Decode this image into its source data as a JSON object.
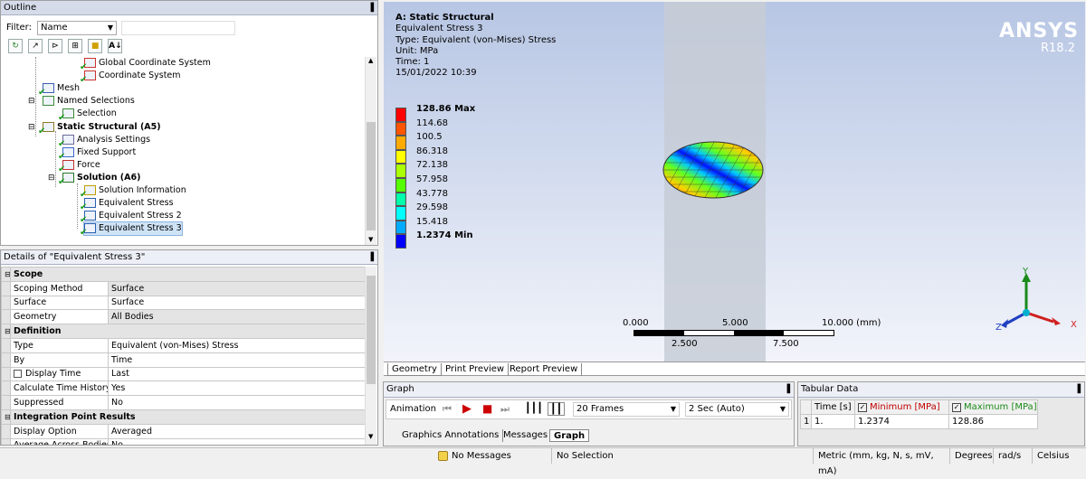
{
  "outline": {
    "title": "Outline",
    "filter_label": "Filter:",
    "filter_value": "Name",
    "tree": [
      {
        "label": "Global Coordinate System",
        "indent": 4,
        "icon": "coordinate-icon",
        "check": true,
        "bold": false
      },
      {
        "label": "Coordinate System",
        "indent": 4,
        "icon": "coordinate-icon",
        "check": true,
        "bold": false
      },
      {
        "label": "Mesh",
        "indent": 2,
        "icon": "mesh-icon",
        "check": true,
        "bold": false
      },
      {
        "label": "Named Selections",
        "indent": 2,
        "icon": "named-selection-icon",
        "check": false,
        "bold": false
      },
      {
        "label": "Selection",
        "indent": 3,
        "icon": "selection-icon",
        "check": true,
        "bold": false
      },
      {
        "label": "Static Structural (A5)",
        "indent": 2,
        "icon": "static-structural-icon",
        "check": true,
        "bold": true
      },
      {
        "label": "Analysis Settings",
        "indent": 3,
        "icon": "analysis-settings-icon",
        "check": true,
        "bold": false
      },
      {
        "label": "Fixed Support",
        "indent": 3,
        "icon": "fixed-support-icon",
        "check": true,
        "bold": false
      },
      {
        "label": "Force",
        "indent": 3,
        "icon": "force-icon",
        "check": true,
        "bold": false
      },
      {
        "label": "Solution (A6)",
        "indent": 3,
        "icon": "solution-icon",
        "check": true,
        "bold": true
      },
      {
        "label": "Solution Information",
        "indent": 4,
        "icon": "solution-information-icon",
        "check": true,
        "bold": false
      },
      {
        "label": "Equivalent Stress",
        "indent": 4,
        "icon": "result-icon",
        "check": true,
        "bold": false
      },
      {
        "label": "Equivalent Stress 2",
        "indent": 4,
        "icon": "result-icon",
        "check": true,
        "bold": false
      },
      {
        "label": "Equivalent Stress 3",
        "indent": 4,
        "icon": "result-icon",
        "check": true,
        "bold": false,
        "selected": true
      }
    ]
  },
  "details": {
    "title": "Details of \"Equivalent Stress 3\"",
    "rows": [
      {
        "section": "Scope"
      },
      {
        "key": "Scoping Method",
        "value": "Surface",
        "shaded": true
      },
      {
        "key": "Surface",
        "value": "Surface"
      },
      {
        "key": "Geometry",
        "value": "All Bodies",
        "shaded": true
      },
      {
        "section": "Definition"
      },
      {
        "key": "Type",
        "value": "Equivalent (von-Mises) Stress"
      },
      {
        "key": "By",
        "value": "Time"
      },
      {
        "key": "Display Time",
        "value": "Last",
        "checkbox": true
      },
      {
        "key": "Calculate Time History",
        "value": "Yes"
      },
      {
        "key": "Suppressed",
        "value": "No"
      },
      {
        "section": "Integration Point Results"
      },
      {
        "key": "Display Option",
        "value": "Averaged"
      },
      {
        "key": "Average Across Bodies",
        "value": "No"
      }
    ]
  },
  "viewport": {
    "header": {
      "title": "A: Static Structural",
      "line1": "Equivalent Stress 3",
      "line2": "Type: Equivalent (von-Mises) Stress",
      "line3": "Unit: MPa",
      "line4": "Time: 1",
      "line5": "15/01/2022 10:39"
    },
    "logo": "ANSYS",
    "version": "R18.2",
    "legend": [
      {
        "label": "128.86 Max",
        "color": "#ff0000",
        "bold": true
      },
      {
        "label": "114.68",
        "color": "#ff5500"
      },
      {
        "label": "100.5",
        "color": "#ffaa00"
      },
      {
        "label": "86.318",
        "color": "#ffff00"
      },
      {
        "label": "72.138",
        "color": "#aaff00"
      },
      {
        "label": "57.958",
        "color": "#55ff00"
      },
      {
        "label": "43.778",
        "color": "#00ffaa"
      },
      {
        "label": "29.598",
        "color": "#00ffff"
      },
      {
        "label": "15.418",
        "color": "#00aaff"
      },
      {
        "label": "1.2374 Min",
        "color": "#0000ff",
        "bold": true
      }
    ],
    "scale": {
      "t0": "0.000",
      "t1": "5.000",
      "t2": "10.000 (mm)",
      "b0": "2.500",
      "b1": "7.500"
    },
    "axes": {
      "y": "Y",
      "x": "X",
      "z": "Z"
    },
    "tabs": [
      "Geometry",
      "Print Preview",
      "Report Preview"
    ]
  },
  "graph": {
    "title": "Graph",
    "animation_label": "Animation",
    "frames": "20 Frames",
    "duration": "2 Sec (Auto)",
    "tabs": [
      "Graphics Annotations",
      "Messages",
      "Graph"
    ]
  },
  "tabular": {
    "title": "Tabular Data",
    "headers": [
      "Time [s]",
      "Minimum [MPa]",
      "Maximum [MPa]"
    ],
    "rows": [
      {
        "index": "1",
        "time": "1.",
        "min": "1.2374",
        "max": "128.86"
      }
    ]
  },
  "status": {
    "messages": "No Messages",
    "selection": "No Selection",
    "units": "Metric (mm, kg, N, s, mV, mA)",
    "angle": "Degrees",
    "rate": "rad/s",
    "temp": "Celsius"
  },
  "colors": {
    "panel_header": "#d6dbe9",
    "viewport_top": "#b7c6e4",
    "viewport_bottom": "#f2f4fa"
  }
}
